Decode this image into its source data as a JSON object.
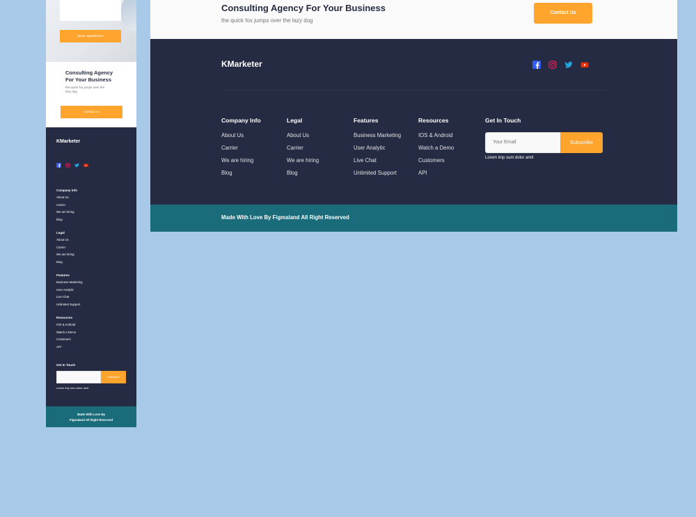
{
  "mobile": {
    "hero": {
      "button_label": "Book Appointment"
    },
    "cta": {
      "title": "Consulting Agency For Your Business",
      "subtitle": "the quick fox jumps over the lazy dog",
      "button_label": "Contact Us"
    },
    "footer": {
      "brand": "KMarketer",
      "columns": [
        {
          "title": "Company Info",
          "links": [
            "About Us",
            "Carrier",
            "We are hiring",
            "Blog"
          ]
        },
        {
          "title": "Legal",
          "links": [
            "About Us",
            "Carrier",
            "We are hiring",
            "Blog"
          ]
        },
        {
          "title": "Features",
          "links": [
            "Business Marketing",
            "User Analytic",
            "Live Chat",
            "Unlimited Support"
          ]
        },
        {
          "title": "Resources",
          "links": [
            "IOS & Android",
            "Watch a Demo",
            "Customers",
            "API"
          ]
        }
      ],
      "touch": {
        "title": "Get In Touch",
        "subscribe_label": "Subscribe",
        "note": "Lorem imp sum dolor amit"
      },
      "copyright_line1": "Made With Love By",
      "copyright_line2": "Figmaland All Right Reserved"
    }
  },
  "desktop": {
    "cta": {
      "title": "Consulting Agency For Your Business",
      "subtitle": "the quick fox jumps over the lazy dog",
      "button_label": "Contact Us"
    },
    "footer": {
      "brand": "KMarketer",
      "columns": [
        {
          "title": "Company Info",
          "links": [
            "About Us",
            "Carrier",
            "We are hiring",
            "Blog"
          ]
        },
        {
          "title": "Legal",
          "links": [
            "About Us",
            "Carrier",
            "We are hiring",
            "Blog"
          ]
        },
        {
          "title": "Features",
          "links": [
            "Business Marketing",
            "User Analytic",
            "Live Chat",
            "Unlimited Support"
          ]
        },
        {
          "title": "Resources",
          "links": [
            "IOS & Android",
            "Watch a Demo",
            "Customers",
            "API"
          ]
        }
      ],
      "touch": {
        "title": "Get In Touch",
        "email_placeholder": "Your Email",
        "subscribe_label": "Subscribe",
        "note": "Lorem imp sum dolor amit"
      },
      "copyright": "Made With Love By Figmaland All Right Reserved"
    }
  },
  "social_icons": [
    "facebook-icon",
    "instagram-icon",
    "twitter-icon",
    "youtube-icon"
  ],
  "colors": {
    "accent": "#ffa52d",
    "footer_bg": "#252b42",
    "bottom_bar": "#1b6c7b",
    "facebook": "#335bf5",
    "instagram": "#e51f5a",
    "twitter": "#21a6df",
    "youtube": "#e42f08"
  }
}
